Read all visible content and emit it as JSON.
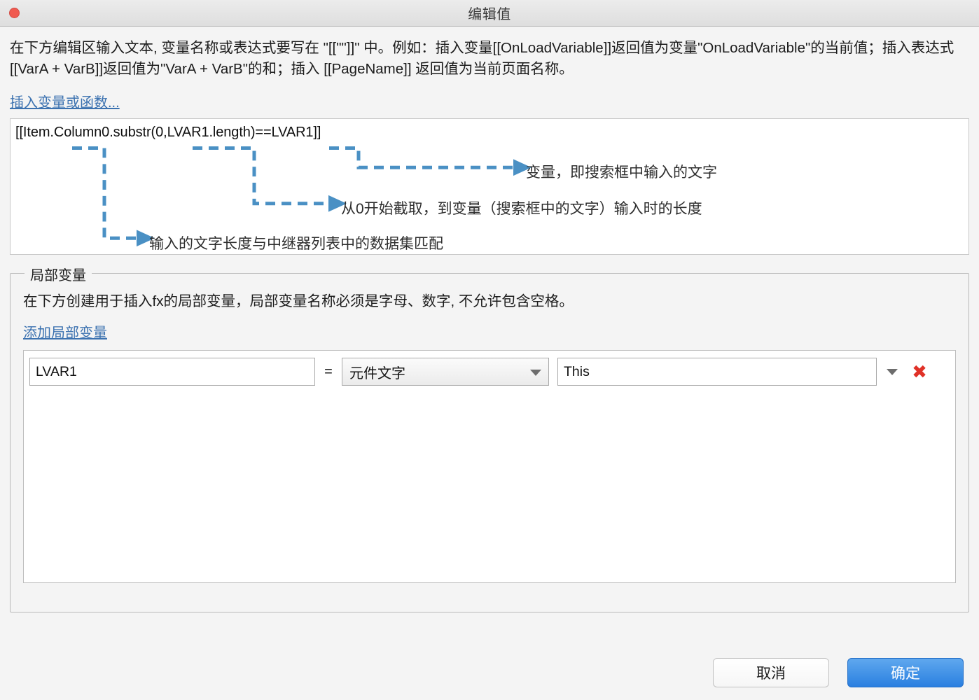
{
  "window": {
    "title": "编辑值",
    "close_icon": "close-icon"
  },
  "intro": {
    "text": "在下方编辑区输入文本, 变量名称或表达式要写在 \"[[\"\"]]\" 中。例如：插入变量[[OnLoadVariable]]返回值为变量\"OnLoadVariable\"的当前值；插入表达式[[VarA + VarB]]返回值为\"VarA + VarB\"的和；插入 [[PageName]] 返回值为当前页面名称。"
  },
  "insert_variable_link": "插入变量或函数...",
  "formula": {
    "value": "[[Item.Column0.substr(0,LVAR1.length)==LVAR1]]",
    "annotations": [
      "变量，即搜索框中输入的文字",
      "从0开始截取，到变量（搜索框中的文字）输入时的长度",
      "输入的文字长度与中继器列表中的数据集匹配"
    ],
    "annotation_color": "#4a90c4"
  },
  "local_vars": {
    "legend": "局部变量",
    "description": "在下方创建用于插入fx的局部变量，局部变量名称必须是字母、数字, 不允许包含空格。",
    "add_link": "添加局部变量",
    "rows": [
      {
        "name": "LVAR1",
        "name_placeholder": "",
        "equals": "=",
        "type": "元件文字",
        "target": "This",
        "target_placeholder": "",
        "delete_icon": "delete-x-icon",
        "type_caret_icon": "chevron-down-icon",
        "target_caret_icon": "chevron-down-icon"
      }
    ]
  },
  "footer": {
    "cancel_label": "取消",
    "ok_label": "确定",
    "ok_color": "#2a7fe0"
  }
}
